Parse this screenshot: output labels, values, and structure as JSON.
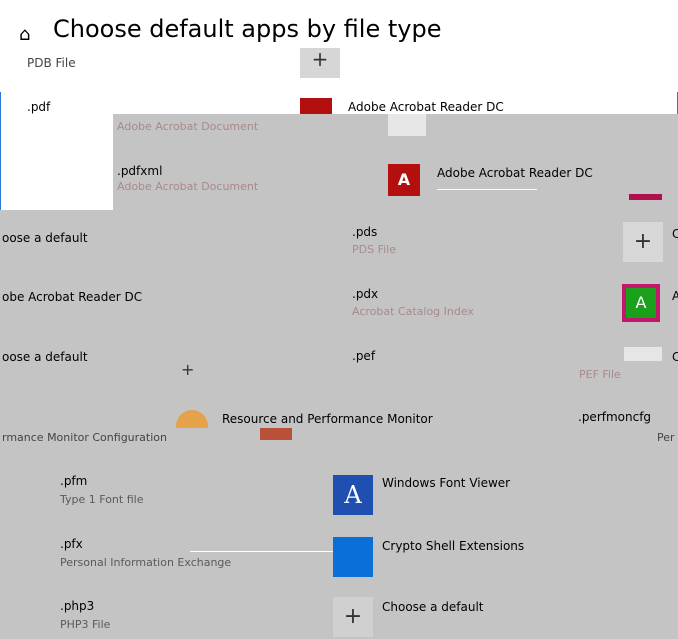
{
  "header": {
    "home_icon": "home-icon",
    "title": "Choose default apps by file type",
    "subtitle": "PDB File"
  },
  "rows": {
    "pdf": {
      "ext": ".pdf",
      "desc": "Adobe Acrobat Document",
      "app": "Adobe Acrobat Reader DC"
    },
    "pdfxml": {
      "ext": ".pdfxml",
      "desc": "Adobe Acrobat Document",
      "app": "Adobe Acrobat Reader DC"
    },
    "pds": {
      "ext": ".pds",
      "desc": "PDS File",
      "left_app": "oose a default",
      "right_app": "C"
    },
    "pdx": {
      "ext": ".pdx",
      "desc": "Acrobat Catalog Index",
      "left_app": "obe Acrobat Reader DC",
      "right_app": "A"
    },
    "pef": {
      "ext": ".pef",
      "desc": "PEF File",
      "left_app": "oose a default",
      "right_app": "C"
    },
    "perfmoncfg": {
      "ext": ".perfmoncfg",
      "left_desc": "rmance Monitor Configuration",
      "app": "Resource and Performance Monitor",
      "right_desc": "Per"
    },
    "pfm": {
      "ext": ".pfm",
      "desc": "Type 1 Font file",
      "app": "Windows Font Viewer"
    },
    "pfx": {
      "ext": ".pfx",
      "desc": "Personal Information Exchange",
      "app": "Crypto Shell Extensions"
    },
    "php3": {
      "ext": ".php3",
      "desc": "PHP3 File",
      "app": "Choose a default"
    }
  },
  "colors": {
    "band": "#c4c4c4",
    "acrobat_red": "#b40f0f",
    "acrobat_green": "#1aa01a",
    "crypto_blue": "#0a6fd8",
    "font_blue": "#1f4fb0"
  }
}
